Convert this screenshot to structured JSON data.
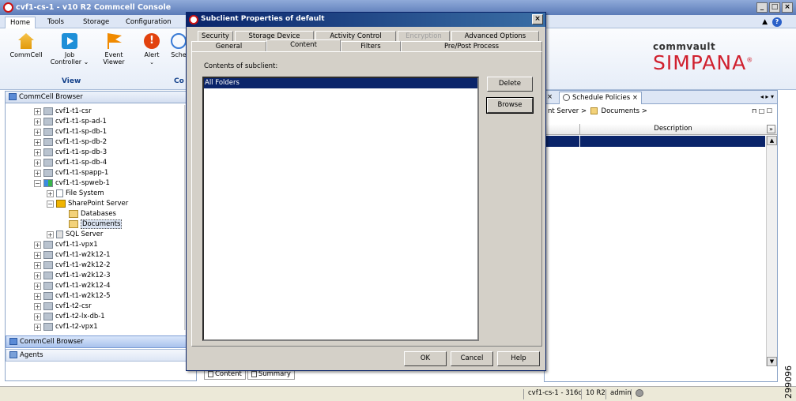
{
  "app": {
    "title": "cvf1-cs-1 - v10 R2 Commcell Console"
  },
  "ribbon": {
    "tabs": [
      "Home",
      "Tools",
      "Storage",
      "Configuration"
    ],
    "buttons": {
      "commcell": "CommCell",
      "job_controller": "Job Controller ⌄",
      "event_viewer": "Event Viewer",
      "alert": "Alert",
      "sche": "Sche"
    },
    "group_view": "View",
    "group_co": "Co",
    "logo_top": "commvault",
    "logo_main": "SIMPANA"
  },
  "leftpane": {
    "header": "CommCell Browser",
    "tree": [
      {
        "label": "cvf1-t1-csr"
      },
      {
        "label": "cvf1-t1-sp-ad-1"
      },
      {
        "label": "cvf1-t1-sp-db-1"
      },
      {
        "label": "cvf1-t1-sp-db-2"
      },
      {
        "label": "cvf1-t1-sp-db-3"
      },
      {
        "label": "cvf1-t1-sp-db-4"
      },
      {
        "label": "cvf1-t1-spapp-1"
      },
      {
        "label": "cvf1-t1-spweb-1"
      },
      {
        "label": "File System"
      },
      {
        "label": "SharePoint Server"
      },
      {
        "label": "Databases"
      },
      {
        "label": "Documents"
      },
      {
        "label": "SQL Server"
      },
      {
        "label": "cvf1-t1-vpx1"
      },
      {
        "label": "cvf1-t1-w2k12-1"
      },
      {
        "label": "cvf1-t1-w2k12-2"
      },
      {
        "label": "cvf1-t1-w2k12-3"
      },
      {
        "label": "cvf1-t1-w2k12-4"
      },
      {
        "label": "cvf1-t1-w2k12-5"
      },
      {
        "label": "cvf1-t2-csr"
      },
      {
        "label": "cvf1-t2-lx-db-1"
      },
      {
        "label": "cvf1-t2-vpx1"
      }
    ],
    "bar_browser": "CommCell Browser",
    "bar_agents": "Agents"
  },
  "rightpane": {
    "tab": "Schedule Policies",
    "crumb_server": "nt Server >",
    "crumb_docs": "Documents >",
    "col_desc": "Description",
    "bottom_tabs": [
      "Content",
      "Summary"
    ]
  },
  "dialog": {
    "title": "Subclient Properties of default",
    "tabs_row1": [
      "Security",
      "Storage Device",
      "Activity Control",
      "Encryption",
      "Advanced Options"
    ],
    "tabs_row2": [
      "General",
      "Content",
      "Filters",
      "Pre/Post Process"
    ],
    "contents_label": "Contents of subclient:",
    "items": [
      "All Folders"
    ],
    "delete": "Delete",
    "browse": "Browse",
    "ok": "OK",
    "cancel": "Cancel",
    "help": "Help"
  },
  "statusbar": {
    "server": "cvf1-cs-1 - 316c",
    "version": "10 R2",
    "user": "admin"
  },
  "side_number": "299096"
}
